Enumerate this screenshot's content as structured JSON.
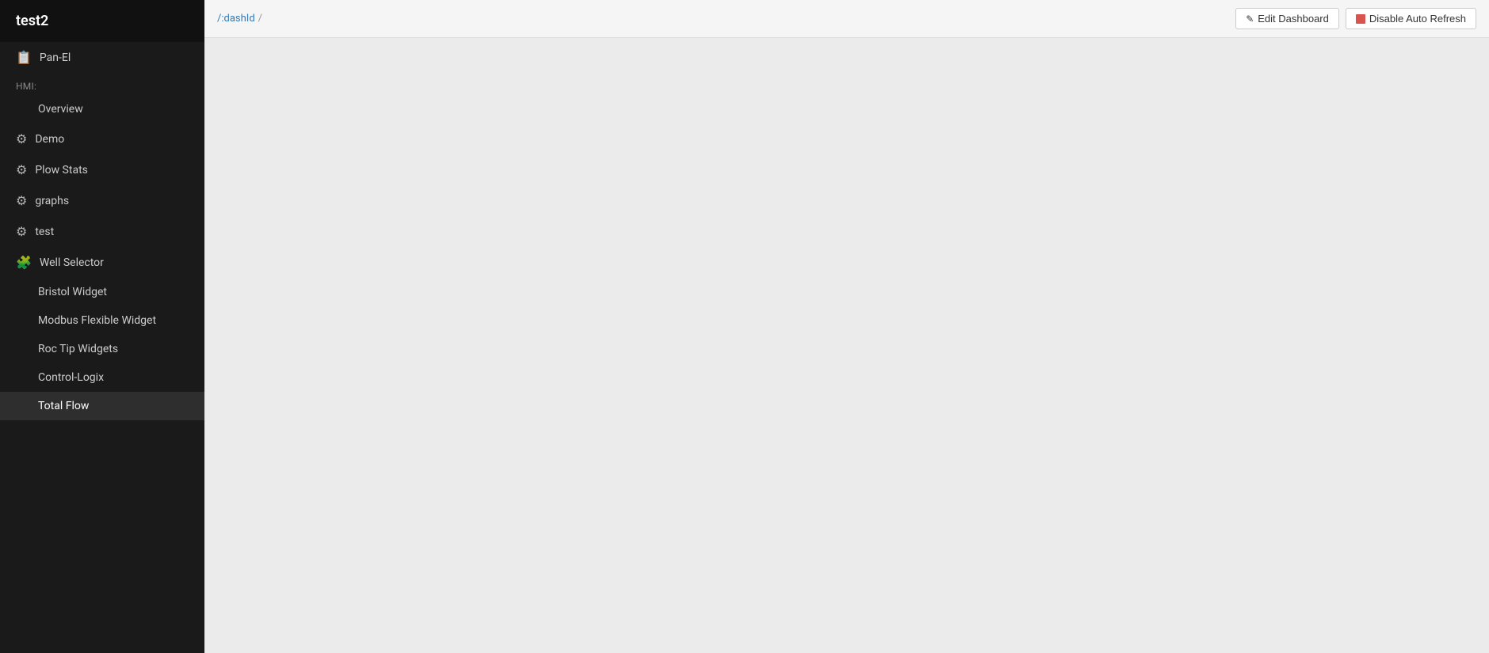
{
  "app": {
    "title": "test2"
  },
  "sidebar": {
    "section_hmi": "HMI:",
    "items": [
      {
        "id": "pan-el",
        "label": "Pan-El",
        "icon": "📋",
        "type": "icon-item"
      },
      {
        "id": "hmi-header",
        "label": "HMI:",
        "type": "section-header"
      },
      {
        "id": "overview",
        "label": "Overview",
        "type": "plain"
      },
      {
        "id": "demo",
        "label": "Demo",
        "icon": "⚙",
        "type": "icon-item"
      },
      {
        "id": "plow-stats",
        "label": "Plow Stats",
        "icon": "⚙",
        "type": "icon-item"
      },
      {
        "id": "graphs",
        "label": "graphs",
        "icon": "⚙",
        "type": "icon-item"
      },
      {
        "id": "test",
        "label": "test",
        "icon": "⚙",
        "type": "icon-item"
      },
      {
        "id": "well-selector",
        "label": "Well Selector",
        "icon": "🧩",
        "type": "icon-item"
      },
      {
        "id": "bristol-widget",
        "label": "Bristol Widget",
        "type": "plain"
      },
      {
        "id": "modbus-flexible-widget",
        "label": "Modbus Flexible Widget",
        "type": "plain"
      },
      {
        "id": "roc-tip-widgets",
        "label": "Roc Tip Widgets",
        "type": "plain"
      },
      {
        "id": "control-logix",
        "label": "Control-Logix",
        "type": "plain"
      },
      {
        "id": "total-flow",
        "label": "Total Flow",
        "type": "plain",
        "active": true
      }
    ]
  },
  "topbar": {
    "breadcrumb_link": "/:dashId",
    "breadcrumb_separator": "/",
    "edit_dashboard_label": "Edit Dashboard",
    "disable_auto_refresh_label": "Disable Auto Refresh"
  }
}
